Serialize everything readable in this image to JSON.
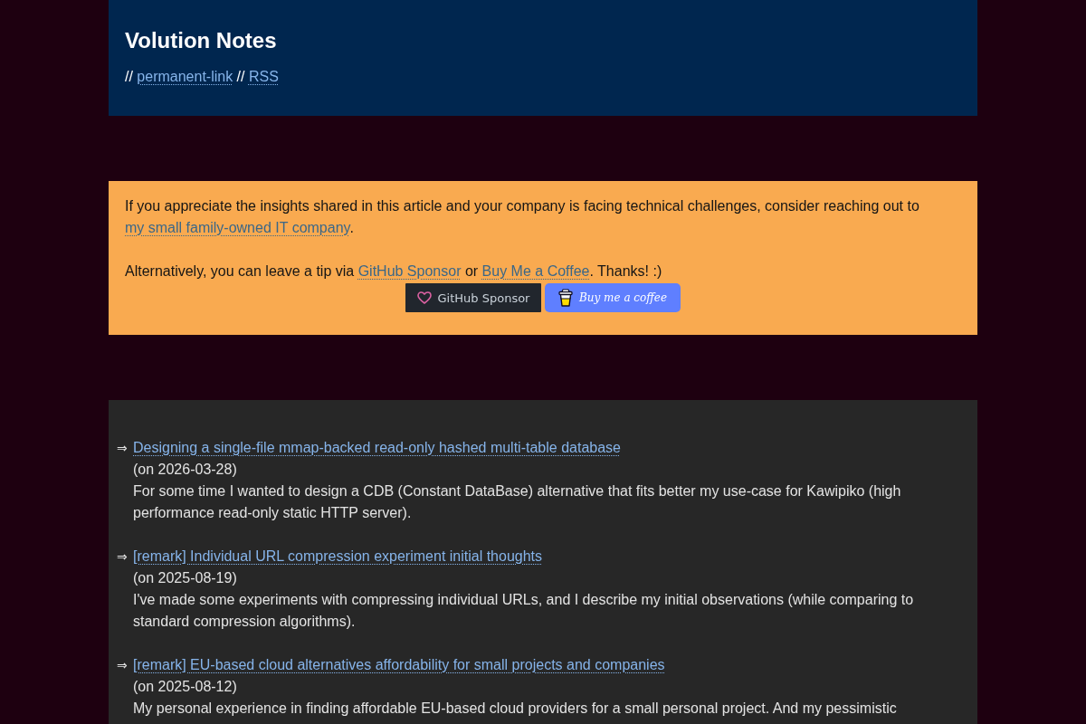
{
  "header": {
    "title": "Volution Notes",
    "nav": [
      {
        "kind": "text",
        "text": "// "
      },
      {
        "kind": "link",
        "text": "permanent-link"
      },
      {
        "kind": "text",
        "text": " // "
      },
      {
        "kind": "link",
        "text": "RSS"
      }
    ]
  },
  "support_box": {
    "paragraphs": [
      [
        {
          "kind": "text",
          "text": "If you appreciate the insights shared in this article and your company is facing technical challenges, consider reaching out to "
        },
        {
          "kind": "link",
          "text": "my small family-owned IT company"
        },
        {
          "kind": "text",
          "text": "."
        }
      ],
      [
        {
          "kind": "text",
          "text": "Alternatively, you can leave a tip via "
        },
        {
          "kind": "link",
          "text": "GitHub Sponsor"
        },
        {
          "kind": "text",
          "text": " or "
        },
        {
          "kind": "link",
          "text": "Buy Me a Coffee"
        },
        {
          "kind": "text",
          "text": ". Thanks! :)"
        }
      ]
    ],
    "buttons": [
      {
        "kind": "github",
        "label": "GitHub Sponsor"
      },
      {
        "kind": "coffee",
        "label": "Buy me a coffee"
      }
    ]
  },
  "articles": [
    {
      "marker": "⇒",
      "title": "Designing a single-file mmap-backed read-only hashed multi-table database",
      "date": "(on 2026-03-28)",
      "summary": "For some time I wanted to design a CDB (Constant DataBase) alternative that fits better my use-case for Kawipiko (high performance read-only static HTTP server)."
    },
    {
      "marker": "⇒",
      "title": "[remark] Individual URL compression experiment initial thoughts",
      "date": "(on 2025-08-19)",
      "summary": "I've made some experiments with compressing individual URLs, and I describe my initial observations (while comparing to standard compression algorithms)."
    },
    {
      "marker": "⇒",
      "title": "[remark] EU-based cloud alternatives affordability for small projects and companies",
      "date": "(on 2025-08-12)",
      "summary": "My personal experience in finding affordable EU-based cloud providers for a small personal project. And my pessimistic"
    }
  ]
}
